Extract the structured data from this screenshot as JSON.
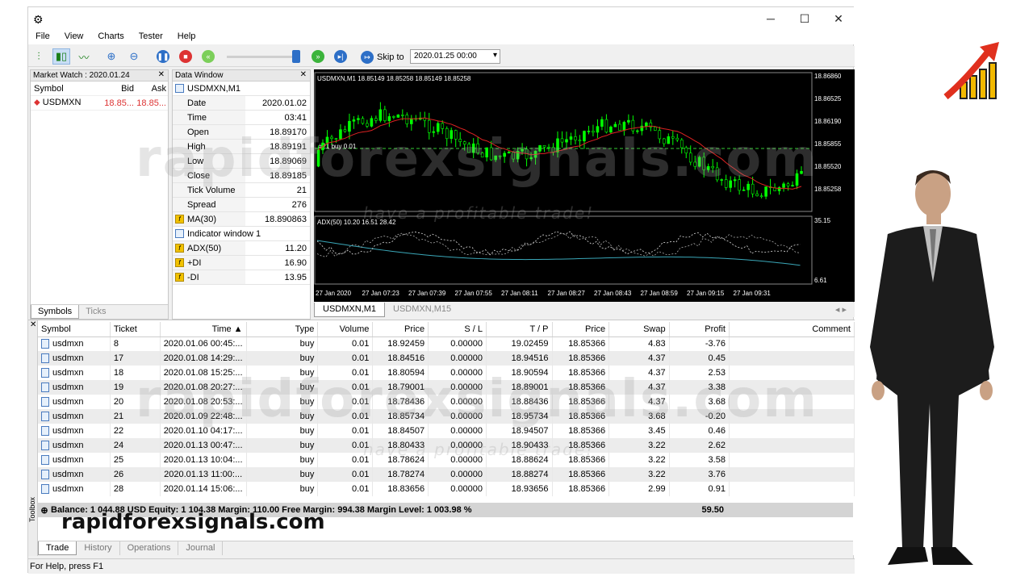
{
  "window": {
    "minimize": "─",
    "maximize": "☐",
    "close": "✕"
  },
  "menu": [
    "File",
    "View",
    "Charts",
    "Tester",
    "Help"
  ],
  "toolbar": {
    "skip_label": "Skip to",
    "skip_date": "2020.01.25 00:00"
  },
  "market_watch": {
    "title": "Market Watch : 2020.01.24",
    "columns": [
      "Symbol",
      "Bid",
      "Ask"
    ],
    "rows": [
      {
        "symbol": "USDMXN",
        "bid": "18.85...",
        "ask": "18.85..."
      }
    ],
    "tabs": [
      "Symbols",
      "Ticks"
    ]
  },
  "data_window": {
    "title": "Data Window",
    "symbol": "USDMXN,M1",
    "rows": [
      {
        "k": "Date",
        "v": "2020.01.02"
      },
      {
        "k": "Time",
        "v": "03:41"
      },
      {
        "k": "Open",
        "v": "18.89170"
      },
      {
        "k": "High",
        "v": "18.89191"
      },
      {
        "k": "Low",
        "v": "18.89069"
      },
      {
        "k": "Close",
        "v": "18.89185"
      },
      {
        "k": "Tick Volume",
        "v": "21"
      },
      {
        "k": "Spread",
        "v": "276"
      }
    ],
    "ma": {
      "k": "MA(30)",
      "v": "18.890863"
    },
    "indicator_window": "Indicator window 1",
    "adx_rows": [
      {
        "k": "ADX(50)",
        "v": "11.20"
      },
      {
        "k": "+DI",
        "v": "16.90"
      },
      {
        "k": "-DI",
        "v": "13.95"
      }
    ]
  },
  "chart": {
    "header": "USDMXN,M1  18.85149 18.85258 18.85149 18.85258",
    "trade_label": "#21 buy 0.01",
    "price_ticks": [
      "18.86860",
      "18.86525",
      "18.86190",
      "18.85855",
      "18.85520",
      "18.85258"
    ],
    "indicator_header": "ADX(50) 10.20 16.51 28.42",
    "indicator_ticks": [
      "35.15",
      "6.61"
    ],
    "time_ticks": [
      "27 Jan 2020",
      "27 Jan 07:23",
      "27 Jan 07:39",
      "27 Jan 07:55",
      "27 Jan 08:11",
      "27 Jan 08:27",
      "27 Jan 08:43",
      "27 Jan 08:59",
      "27 Jan 09:15",
      "27 Jan 09:31"
    ],
    "tabs": [
      "USDMXN,M1",
      "USDMXN,M15"
    ]
  },
  "terminal": {
    "columns": [
      "Symbol",
      "Ticket",
      "Time",
      "Type",
      "Volume",
      "Price",
      "S / L",
      "T / P",
      "Price",
      "Swap",
      "Profit",
      "Comment"
    ],
    "rows": [
      [
        "usdmxn",
        "8",
        "2020.01.06 00:45:...",
        "buy",
        "0.01",
        "18.92459",
        "0.00000",
        "19.02459",
        "18.85366",
        "4.83",
        "-3.76"
      ],
      [
        "usdmxn",
        "17",
        "2020.01.08 14:29:...",
        "buy",
        "0.01",
        "18.84516",
        "0.00000",
        "18.94516",
        "18.85366",
        "4.37",
        "0.45"
      ],
      [
        "usdmxn",
        "18",
        "2020.01.08 15:25:...",
        "buy",
        "0.01",
        "18.80594",
        "0.00000",
        "18.90594",
        "18.85366",
        "4.37",
        "2.53"
      ],
      [
        "usdmxn",
        "19",
        "2020.01.08 20:27:...",
        "buy",
        "0.01",
        "18.79001",
        "0.00000",
        "18.89001",
        "18.85366",
        "4.37",
        "3.38"
      ],
      [
        "usdmxn",
        "20",
        "2020.01.08 20:53:...",
        "buy",
        "0.01",
        "18.78436",
        "0.00000",
        "18.88436",
        "18.85366",
        "4.37",
        "3.68"
      ],
      [
        "usdmxn",
        "21",
        "2020.01.09 22:48:...",
        "buy",
        "0.01",
        "18.85734",
        "0.00000",
        "18.95734",
        "18.85366",
        "3.68",
        "-0.20"
      ],
      [
        "usdmxn",
        "22",
        "2020.01.10 04:17:...",
        "buy",
        "0.01",
        "18.84507",
        "0.00000",
        "18.94507",
        "18.85366",
        "3.45",
        "0.46"
      ],
      [
        "usdmxn",
        "24",
        "2020.01.13 00:47:...",
        "buy",
        "0.01",
        "18.80433",
        "0.00000",
        "18.90433",
        "18.85366",
        "3.22",
        "2.62"
      ],
      [
        "usdmxn",
        "25",
        "2020.01.13 10:04:...",
        "buy",
        "0.01",
        "18.78624",
        "0.00000",
        "18.88624",
        "18.85366",
        "3.22",
        "3.58"
      ],
      [
        "usdmxn",
        "26",
        "2020.01.13 11:00:...",
        "buy",
        "0.01",
        "18.78274",
        "0.00000",
        "18.88274",
        "18.85366",
        "3.22",
        "3.76"
      ],
      [
        "usdmxn",
        "28",
        "2020.01.14 15:06:...",
        "buy",
        "0.01",
        "18.83656",
        "0.00000",
        "18.93656",
        "18.85366",
        "2.99",
        "0.91"
      ]
    ],
    "balance": "Balance: 1 044.88 USD  Equity: 1 104.38  Margin: 110.00  Free Margin: 994.38  Margin Level: 1 003.98 %",
    "total_profit": "59.50",
    "tabs": [
      "Trade",
      "History",
      "Operations",
      "Journal"
    ],
    "toolbox": "Toolbox"
  },
  "status": "For Help, press F1",
  "watermark": "rapidforexsignals.com",
  "watermark_sub": "have a profitable trade!",
  "brand": "rapidforexsignals.com"
}
